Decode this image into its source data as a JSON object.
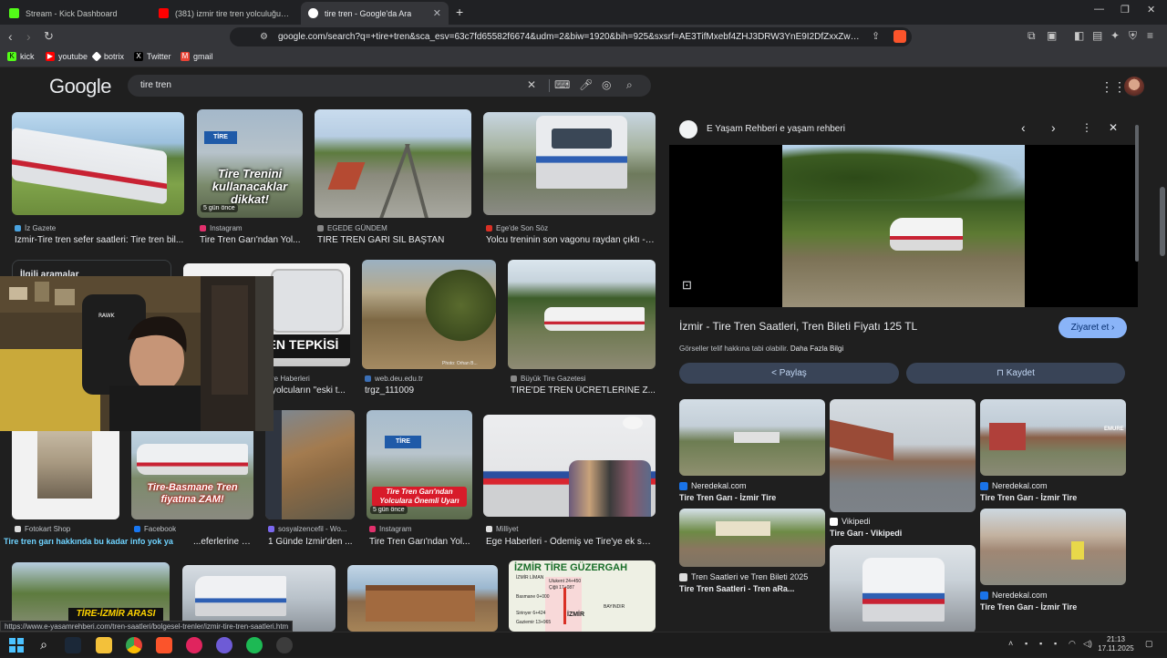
{
  "browser": {
    "tabs": [
      {
        "title": "Stream - Kick Dashboard",
        "color": "#53fc18",
        "active": false
      },
      {
        "title": "(381) izmir tire tren yolculuğuy - You",
        "color": "#ff0000",
        "active": false
      },
      {
        "title": "tire tren - Google'da Ara",
        "color": "#4285f4",
        "active": true
      }
    ],
    "new_tab_icon": "plus-icon",
    "url": "google.com/search?q=+tire+tren&sca_esv=63c7fd65582f6674&udm=2&biw=1920&bih=925&sxsrf=AE3TifMxebf4ZHJ3DRW3YnE9I2DfZxxZw%3A176340...",
    "bookmarks": [
      {
        "label": "kick",
        "color": "#53fc18"
      },
      {
        "label": "youtube",
        "color": "#ff0000"
      },
      {
        "label": "botrix",
        "color": "#ffffff"
      },
      {
        "label": "Twitter",
        "color": "#000000"
      },
      {
        "label": "gmail",
        "color": "#ea4335"
      }
    ]
  },
  "google": {
    "logo": "Google",
    "query": "tire tren"
  },
  "results": {
    "row1": [
      {
        "source": "İz Gazete",
        "title": "İzmir-Tire tren sefer saatleri: Tire tren bil...",
        "source_color": "#4aa3df"
      },
      {
        "source": "Instagram",
        "title": "Tire Tren Garı'ndan Yol...",
        "source_color": "#e1306c",
        "overlay": "Tire Trenini kullanacaklar dikkat!",
        "badge": "5 gün önce",
        "sign": "TİRE"
      },
      {
        "source": "EGEDE GÜNDEM",
        "title": "TİRE TREN GARI SİL BAŞTAN",
        "source_color": "#888888"
      },
      {
        "source": "Ege'de Son Söz",
        "title": "Yolcu treninin son vagonu raydan çıktı - İ...",
        "source_color": "#d93025"
      }
    ],
    "row2_related": "İlgili aramalar",
    "row2": [
      {
        "source": "re Haberleri",
        "title": "yolcuların \"eski t...",
        "overlay": "EN TEPKİSİ"
      },
      {
        "source": "web.deu.edu.tr",
        "title": "trgz_111009",
        "source_color": "#3b6fb6",
        "credit": "Photo: Orhan B..."
      },
      {
        "source": "Büyük Tire Gazetesi",
        "title": "TİRE'DE TREN ÜCRETLERİNE Z...",
        "source_color": "#888888"
      }
    ],
    "row3": [
      {
        "source": "Fotokart Shop",
        "title": "Tire tren garı hakkında bu kadar info yok ya",
        "source_color": "#dddddd"
      },
      {
        "source": "Facebook",
        "title": "...eferlerine zam...",
        "source_color": "#1877f2",
        "overlay": "Tire-Basmane Tren fiyatına ZAM!"
      },
      {
        "source": "sosyalzencefil - Wo...",
        "title": "1 Günde İzmir'den ...",
        "source_color": "#7b68ee"
      },
      {
        "source": "Instagram",
        "title": "Tire Tren Garı'ndan Yol...",
        "source_color": "#e1306c",
        "overlay": "Tire Tren Garı'ndan Yolculara Önemli Uyarı",
        "badge": "5 gün önce",
        "sign": "TİRE"
      },
      {
        "source": "Milliyet",
        "title": "Ege Haberleri - Ödemiş ve Tire'ye ek sef...",
        "source_color": "#e0e0e0"
      }
    ],
    "row4": [
      {
        "overlay": "TİRE-İZMİR ARASI"
      },
      {},
      {},
      {
        "map_title": "İZMİR TİRE GÜZERGAH",
        "map_labels": [
          "Ulukent 24+450",
          "Çiğli 17+087",
          "Basmane 0+000",
          "Gaziemir 13+965",
          "Sirinyer 6+424",
          "BAYINDIR",
          "İZMİR",
          "İZMİR LİMAN"
        ]
      }
    ]
  },
  "panel": {
    "site": "E Yaşam Rehberi e yaşam rehberi",
    "title": "İzmir - Tire Tren Saatleri, Tren Bileti Fiyatı 125 TL",
    "visit_label": "Ziyaret et",
    "license_text": "Görseller telif hakkına tabi olabilir.",
    "license_link": "Daha Fazla Bilgi",
    "share_label": "Paylaş",
    "save_label": "Kaydet",
    "related": [
      {
        "source": "Neredekal.com",
        "title": "Tire Tren Garı - İzmir Tire"
      },
      {
        "source": "Vikipedi",
        "title": "Tire Garı - Vikipedi"
      },
      {
        "source": "Neredekal.com",
        "title": "Tire Tren Garı - İzmir Tire",
        "watermark": "EMURE"
      },
      {
        "source": "Tren Saatleri ve Tren Bileti 2025",
        "title": "Tire Tren Saatleri - Tren aRa..."
      },
      {
        "source": "Neredekal.com",
        "title": "Tire Tren Garı - İzmir Tire"
      }
    ]
  },
  "status_url": "https://www.e-yasamrehberi.com/tren-saatleri/bolgesel-trenler/izmir-tire-tren-saatleri.htm",
  "clock": {
    "time": "21:13",
    "date": "17.11.2025"
  },
  "colors": {
    "accent": "#8ab4f8",
    "panel_button": "#394457",
    "visit_button": "#8ab4f8"
  }
}
